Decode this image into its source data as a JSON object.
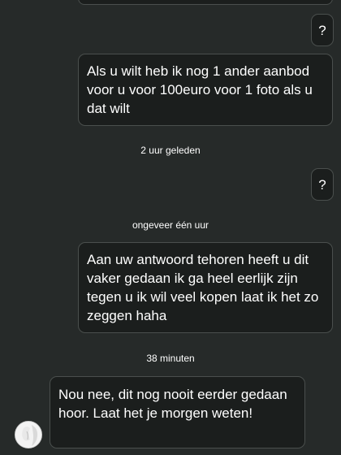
{
  "messages": [
    {
      "side": "out",
      "text": "?"
    },
    {
      "side": "out",
      "text": "Als u wilt heb ik nog 1 ander aanbod voor u voor 100euro voor 1 foto als u dat wilt"
    },
    {
      "type": "timestamp",
      "text": "2 uur geleden"
    },
    {
      "side": "out",
      "text": "?"
    },
    {
      "type": "timestamp",
      "text": "ongeveer één uur"
    },
    {
      "side": "out",
      "text": "Aan uw antwoord tehoren heeft u dit vaker gedaan ik ga heel eerlijk zijn tegen u ik wil veel kopen laat ik het zo zeggen haha"
    },
    {
      "type": "timestamp",
      "text": "38 minuten"
    },
    {
      "side": "in",
      "text": "Nou nee, dit nog nooit eerder gedaan hoor. Laat het je morgen weten!"
    }
  ],
  "colors": {
    "background": "#262a29",
    "bubble": "#1b1e1d",
    "bubble_border": "#4a4f4d",
    "text": "#ffffff"
  },
  "icons": {
    "contact_avatar": "avatar-icon"
  }
}
